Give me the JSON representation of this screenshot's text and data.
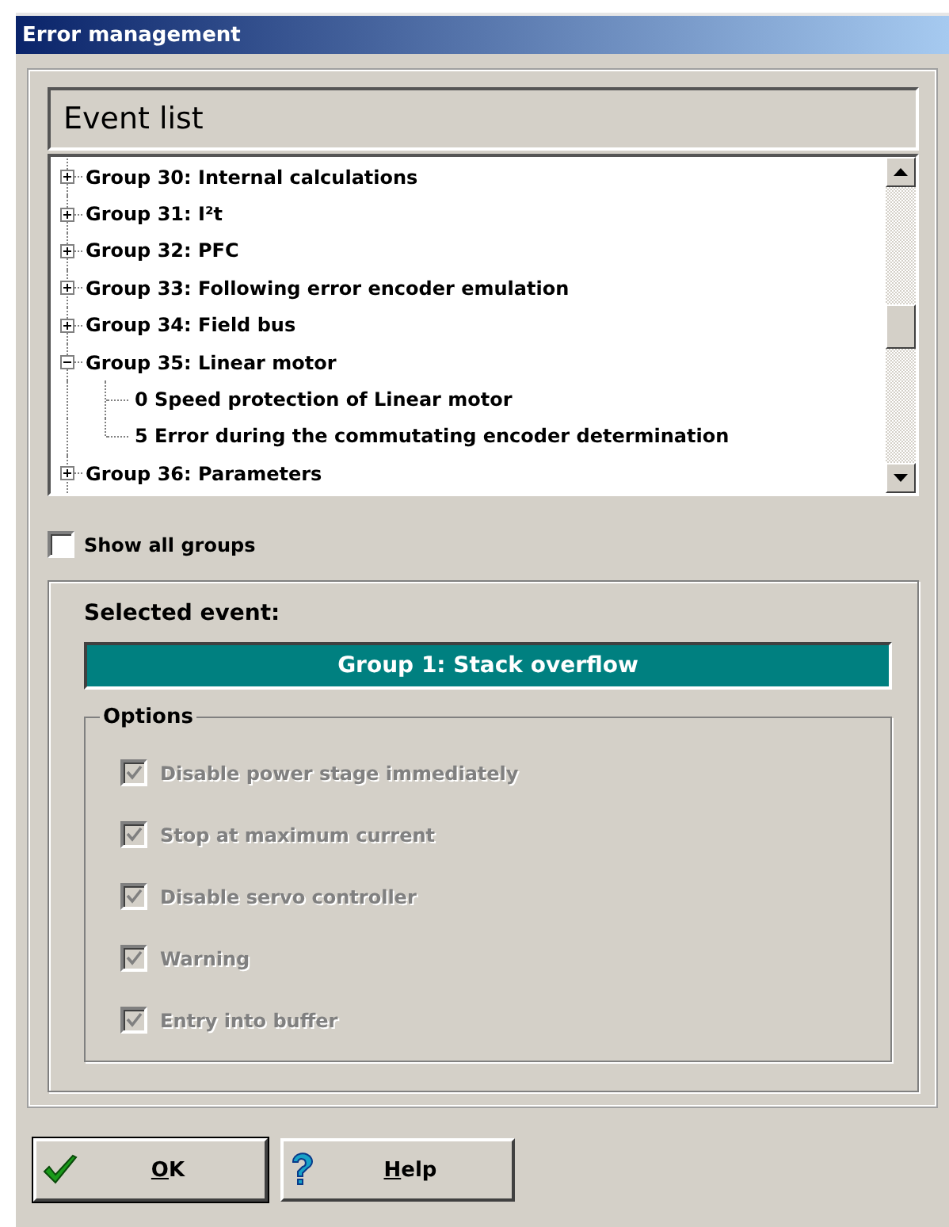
{
  "window": {
    "title": "Error management"
  },
  "event_list": {
    "title": "Event list",
    "items": [
      {
        "label": "Group 30: Internal calculations",
        "expanded": false
      },
      {
        "label": "Group 31: I²t",
        "expanded": false
      },
      {
        "label": "Group 32: PFC",
        "expanded": false
      },
      {
        "label": "Group 33: Following error encoder emulation",
        "expanded": false
      },
      {
        "label": "Group 34: Field bus",
        "expanded": false
      },
      {
        "label": "Group 35: Linear motor",
        "expanded": true,
        "children": [
          {
            "label": "0 Speed protection of Linear motor"
          },
          {
            "label": "5 Error during the commutating encoder determination"
          }
        ]
      },
      {
        "label": "Group 36: Parameters",
        "expanded": false
      }
    ]
  },
  "show_all_groups": {
    "label": "Show all groups",
    "checked": false
  },
  "selected_event": {
    "label": "Selected event:",
    "value": "Group 1: Stack overflow"
  },
  "options": {
    "title": "Options",
    "items": [
      {
        "label": "Disable power stage immediately",
        "checked": true,
        "disabled": true
      },
      {
        "label": "Stop at maximum current",
        "checked": true,
        "disabled": true
      },
      {
        "label": "Disable servo controller",
        "checked": true,
        "disabled": true
      },
      {
        "label": "Warning",
        "checked": true,
        "disabled": true
      },
      {
        "label": "Entry into buffer",
        "checked": true,
        "disabled": true
      }
    ]
  },
  "buttons": [
    {
      "kind": "ok",
      "mnemonic": "O",
      "rest": "K"
    },
    {
      "kind": "help",
      "mnemonic": "H",
      "rest": "elp"
    }
  ]
}
